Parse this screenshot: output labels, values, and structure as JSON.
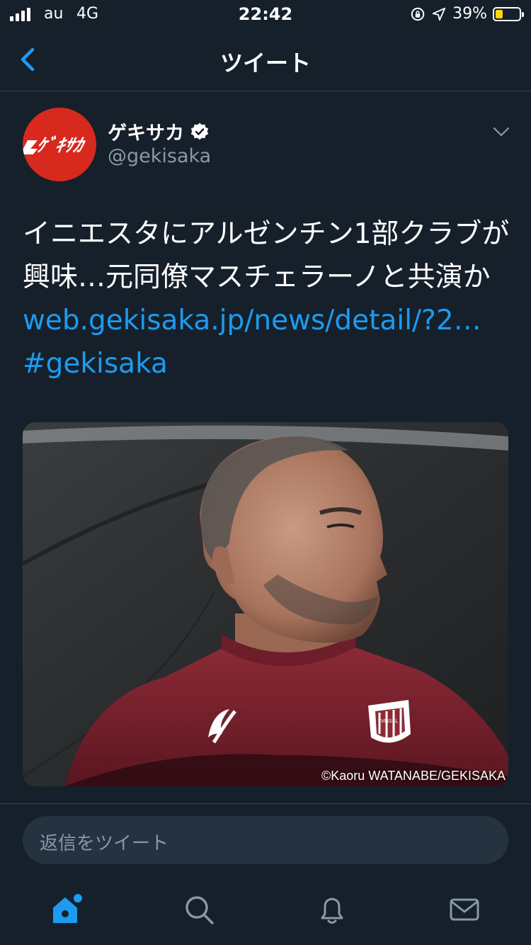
{
  "status_bar": {
    "carrier": "au",
    "network": "4G",
    "time": "22:42",
    "battery": "39%",
    "battery_level": 0.39,
    "battery_color": "#ffd60a"
  },
  "header": {
    "title": "ツイート",
    "back_icon": "chevron-left-icon"
  },
  "tweet": {
    "avatar_text": "ゲキサカ",
    "avatar_color": "#d7291e",
    "name": "ゲキサカ",
    "handle": "@gekisaka",
    "verified": true,
    "text_main": "イニエスタにアルゼンチン1部クラブが興味…元同僚マスチェラーノと共演か ",
    "link": "web.gekisaka.jp/news/detail/?2…",
    "hashtag": "#gekisaka",
    "link_color": "#1d9bf0",
    "media": {
      "credit": "©Kaoru WATANABE/GEKISAKA",
      "shirt_logo": "VISSEL"
    }
  },
  "reply_box": {
    "placeholder": "返信をツイート"
  },
  "tabbar": {
    "items": [
      "home-icon",
      "search-icon",
      "notifications-icon",
      "messages-icon"
    ],
    "active": "home-icon",
    "accent": "#1d9bf0"
  }
}
